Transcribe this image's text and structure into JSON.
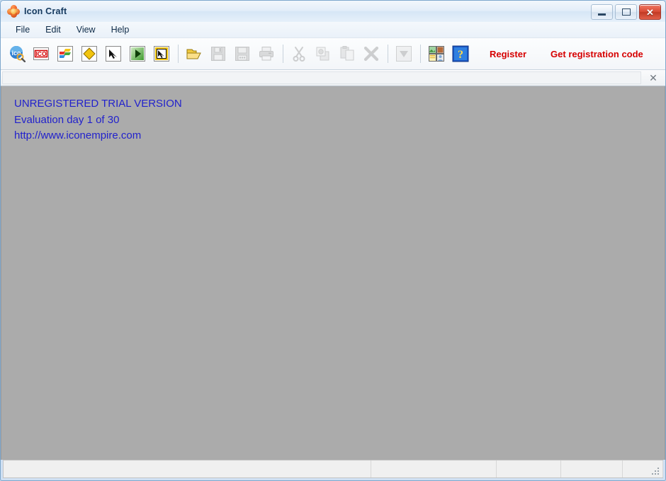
{
  "window": {
    "title": "Icon Craft",
    "app_icon": "flower-icon",
    "controls": [
      {
        "name": "minimize",
        "glyph": "minimize-icon"
      },
      {
        "name": "maximize",
        "glyph": "maximize-icon"
      },
      {
        "name": "close",
        "glyph": "close-icon",
        "label": "✕"
      }
    ]
  },
  "menu": {
    "items": [
      {
        "label": "File"
      },
      {
        "label": "Edit"
      },
      {
        "label": "View"
      },
      {
        "label": "Help"
      }
    ]
  },
  "toolbar": {
    "buttons": [
      {
        "name": "new-icon-library",
        "icon": "ico-magnifier-icon",
        "enabled": true
      },
      {
        "name": "new-ico-file",
        "icon": "ico-red-label-icon",
        "enabled": true
      },
      {
        "name": "new-image",
        "icon": "color-squares-icon",
        "enabled": true
      },
      {
        "name": "new-cursor",
        "icon": "yellow-diamond-icon",
        "enabled": true
      },
      {
        "name": "static-cursor",
        "icon": "arrow-cursor-icon",
        "enabled": true
      },
      {
        "name": "animated-cursor",
        "icon": "green-play-icon",
        "enabled": true
      },
      {
        "name": "capture-cursor",
        "icon": "yellow-cursor-frame-icon",
        "enabled": true
      },
      {
        "name": "open-file",
        "icon": "open-folder-icon",
        "enabled": true
      },
      {
        "name": "save-file",
        "icon": "floppy-save-icon",
        "enabled": false
      },
      {
        "name": "save-as",
        "icon": "floppy-save-as-icon",
        "enabled": false
      },
      {
        "name": "print",
        "icon": "printer-icon",
        "enabled": false
      },
      {
        "name": "cut",
        "icon": "scissors-icon",
        "enabled": false
      },
      {
        "name": "copy",
        "icon": "copy-icon",
        "enabled": false
      },
      {
        "name": "paste",
        "icon": "paste-icon",
        "enabled": false
      },
      {
        "name": "delete",
        "icon": "x-delete-icon",
        "enabled": false
      },
      {
        "name": "dropdown",
        "icon": "chevron-down-icon",
        "enabled": false
      },
      {
        "name": "image-gallery",
        "icon": "media-gallery-icon",
        "enabled": true
      },
      {
        "name": "help",
        "icon": "question-help-icon",
        "enabled": true
      }
    ],
    "register_label": "Register",
    "get_code_label": "Get registration code",
    "register_color": "#d60000"
  },
  "document_strip": {
    "close_label": "✕"
  },
  "workspace": {
    "background_color": "#ababab",
    "text_color": "#2222cc",
    "lines": [
      "UNREGISTERED TRIAL VERSION",
      "Evaluation day 1 of 30",
      "http://www.iconempire.com"
    ]
  },
  "statusbar": {
    "cells": [
      "",
      "",
      "",
      "",
      "",
      ""
    ]
  }
}
